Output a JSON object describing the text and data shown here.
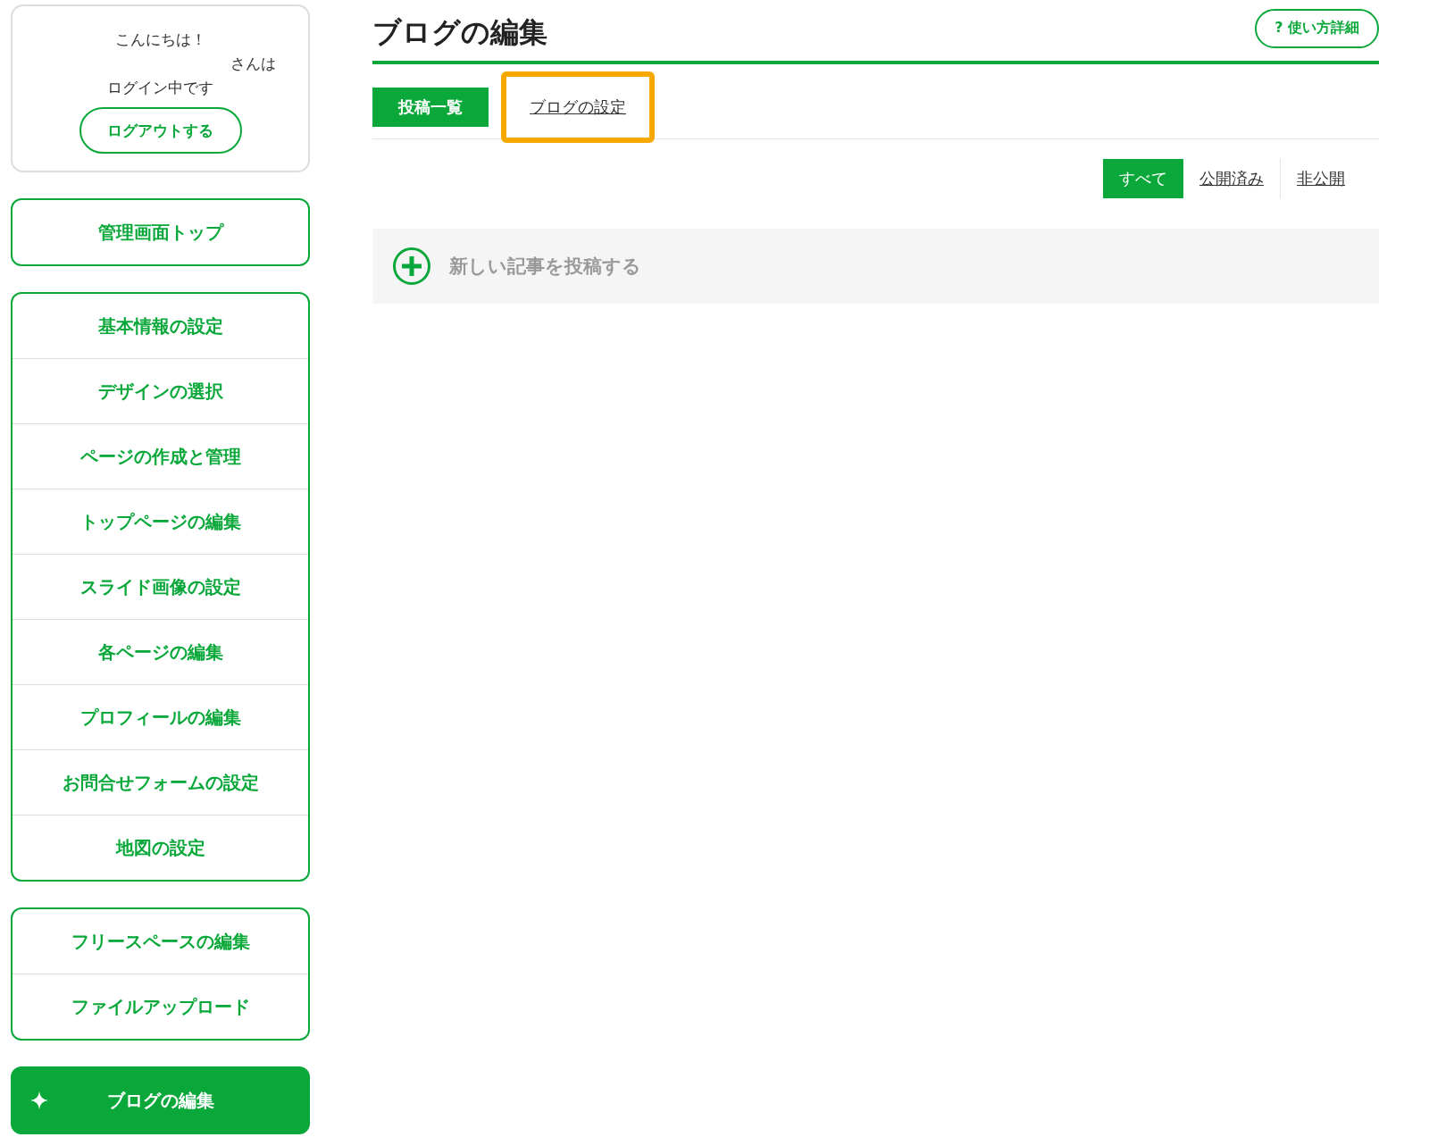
{
  "greeting": {
    "hello": "こんにちは！",
    "user_suffix": "さんは",
    "status": "ログイン中です",
    "logout": "ログアウトする"
  },
  "sidebar": {
    "groups": [
      {
        "items": [
          {
            "label": "管理画面トップ",
            "selected": false
          }
        ]
      },
      {
        "items": [
          {
            "label": "基本情報の設定",
            "selected": false
          },
          {
            "label": "デザインの選択",
            "selected": false
          },
          {
            "label": "ページの作成と管理",
            "selected": false
          },
          {
            "label": "トップページの編集",
            "selected": false
          },
          {
            "label": "スライド画像の設定",
            "selected": false
          },
          {
            "label": "各ページの編集",
            "selected": false
          },
          {
            "label": "プロフィールの編集",
            "selected": false
          },
          {
            "label": "お問合せフォームの設定",
            "selected": false
          },
          {
            "label": "地図の設定",
            "selected": false
          }
        ]
      },
      {
        "items": [
          {
            "label": "フリースペースの編集",
            "selected": false
          },
          {
            "label": "ファイルアップロード",
            "selected": false
          }
        ]
      },
      {
        "items": [
          {
            "label": "ブログの編集",
            "selected": true
          }
        ]
      }
    ]
  },
  "page": {
    "title": "ブログの編集",
    "help": "使い方詳細",
    "help_icon": "?"
  },
  "tabs": [
    {
      "label": "投稿一覧",
      "selected": true,
      "highlighted": false
    },
    {
      "label": "ブログの設定",
      "selected": false,
      "highlighted": true
    }
  ],
  "filters": [
    {
      "label": "すべて",
      "selected": true
    },
    {
      "label": "公開済み",
      "selected": false
    },
    {
      "label": "非公開",
      "selected": false
    }
  ],
  "new_post": {
    "label": "新しい記事を投稿する"
  }
}
